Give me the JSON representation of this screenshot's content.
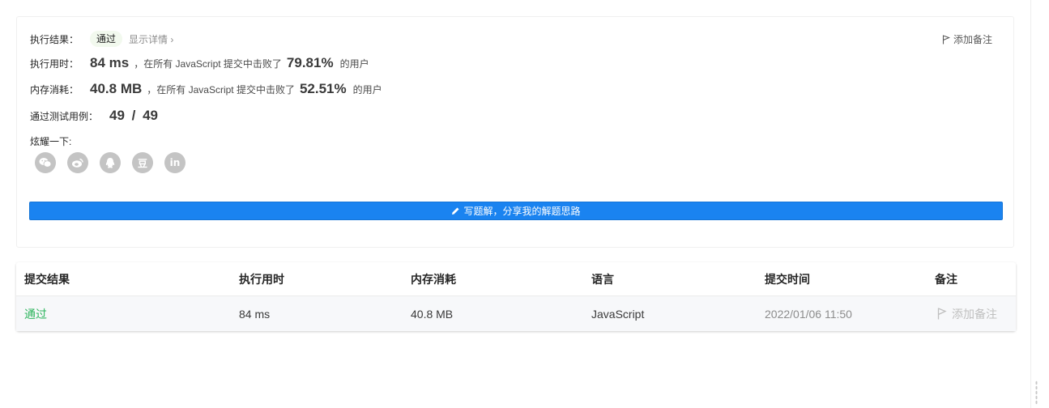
{
  "result": {
    "status_label": "执行结果：",
    "status_badge": "通过",
    "details_link": "显示详情 ›",
    "add_note": "添加备注",
    "runtime": {
      "label": "执行用时：",
      "value": "84 ms",
      "beat_text": "，在所有 JavaScript 提交中击败了",
      "percent": "79.81%",
      "users_text": "的用户"
    },
    "memory": {
      "label": "内存消耗：",
      "value": "40.8 MB",
      "beat_text": "，在所有 JavaScript 提交中击败了",
      "percent": "52.51%",
      "users_text": "的用户"
    },
    "testcases": {
      "label": "通过测试用例：",
      "value": "49 / 49"
    },
    "share": {
      "label": "炫耀一下:",
      "icons": [
        "wechat-icon",
        "weibo-icon",
        "qq-icon",
        "douban-icon",
        "linkedin-icon"
      ],
      "douban_glyph": "豆",
      "linkedin_glyph": "in"
    },
    "write_solution": "写题解，分享我的解题思路"
  },
  "submissions": {
    "headers": [
      "提交结果",
      "执行用时",
      "内存消耗",
      "语言",
      "提交时间",
      "备注"
    ],
    "rows": [
      {
        "status": "通过",
        "runtime": "84 ms",
        "memory": "40.8 MB",
        "language": "JavaScript",
        "time": "2022/01/06 11:50",
        "note": "添加备注"
      }
    ]
  },
  "colors": {
    "accent": "#1a83f0",
    "success": "#2db55d",
    "badge_bg": "#f2f9ee",
    "share_icon": "#c4c4c4"
  }
}
